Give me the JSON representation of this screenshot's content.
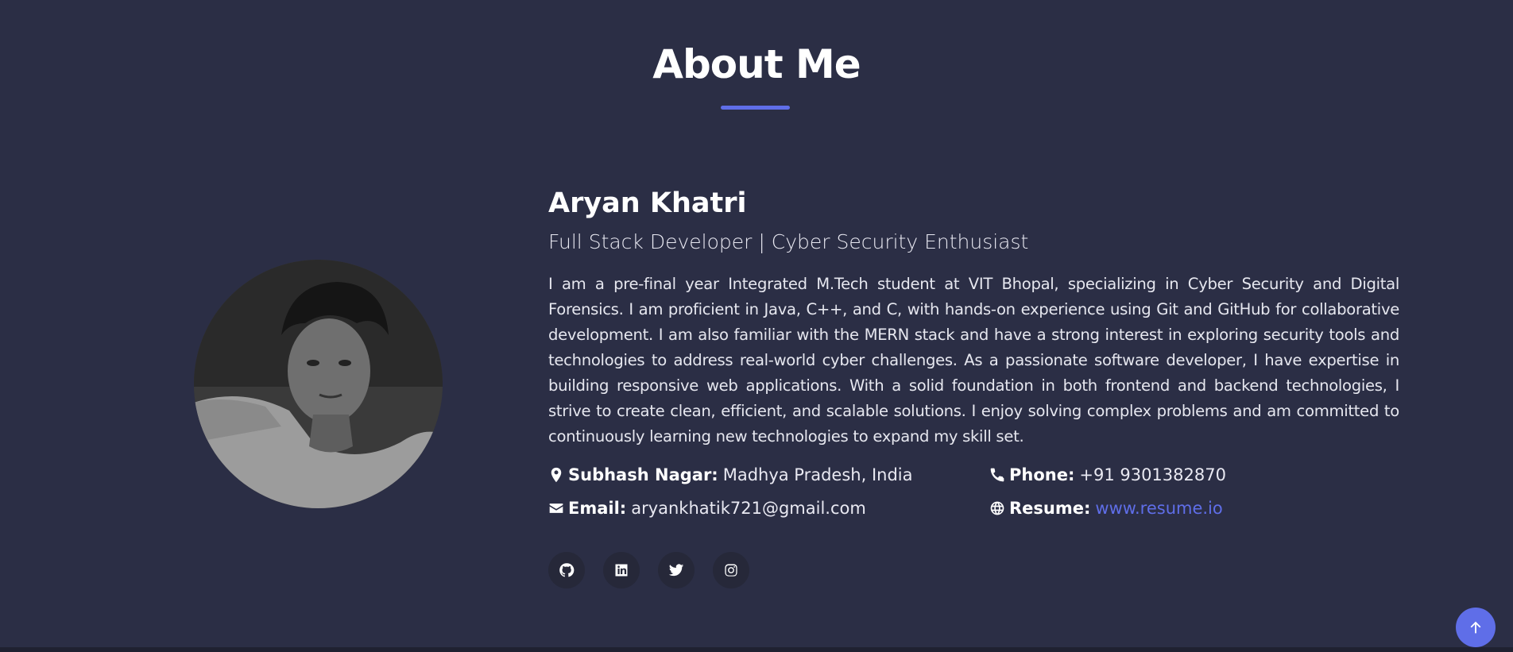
{
  "section": {
    "title": "About Me"
  },
  "profile": {
    "name": "Aryan Khatri",
    "role": "Full Stack Developer | Cyber Security Enthusiast",
    "bio": "I am a pre-final year Integrated M.Tech student at VIT Bhopal, specializing in Cyber Security and Digital Forensics. I am proficient in Java, C++, and C, with hands-on experience using Git and GitHub for collaborative development. I am also familiar with the MERN stack and have a strong interest in exploring security tools and technologies to address real-world cyber challenges. As a passionate software developer, I have expertise in building responsive web applications. With a solid foundation in both frontend and backend technologies, I strive to create clean, efficient, and scalable solutions. I enjoy solving complex problems and am committed to continuously learning new technologies to expand my skill set."
  },
  "info": {
    "location": {
      "icon": "map-marker-icon",
      "label": "Subhash Nagar:",
      "value": "Madhya Pradesh, India"
    },
    "phone": {
      "icon": "phone-icon",
      "label": "Phone:",
      "value": "+91 9301382870"
    },
    "email": {
      "icon": "envelope-icon",
      "label": "Email:",
      "value": "aryankhatik721@gmail.com"
    },
    "resume": {
      "icon": "globe-icon",
      "label": "Resume:",
      "value": "www.resume.io"
    }
  },
  "socials": [
    {
      "icon": "github-icon"
    },
    {
      "icon": "linkedin-icon"
    },
    {
      "icon": "twitter-icon"
    },
    {
      "icon": "instagram-icon"
    }
  ],
  "colors": {
    "background": "#2b2e45",
    "accent": "#5f6ee8",
    "text": "#ffffff",
    "social_bg": "#262839"
  },
  "scroll_top": {
    "icon": "arrow-up-icon"
  }
}
